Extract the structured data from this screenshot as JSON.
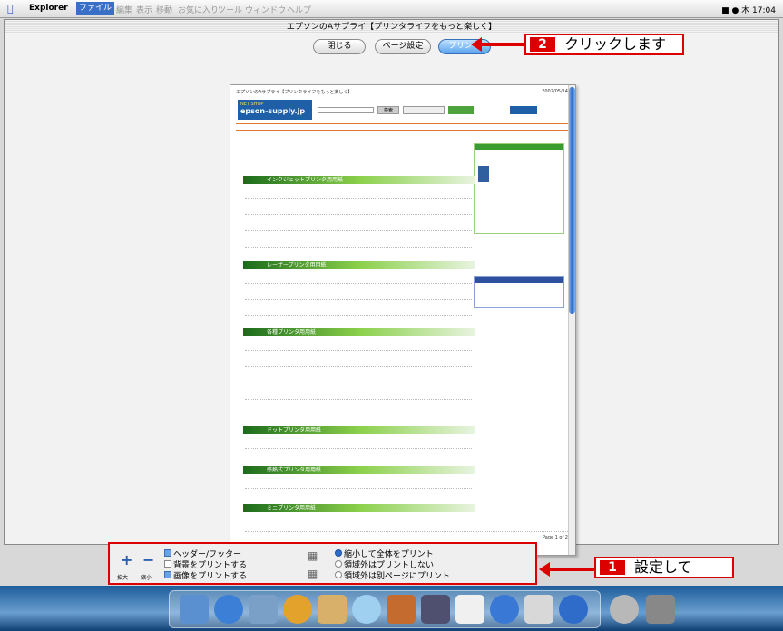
{
  "menubar": {
    "app_name": "Explorer",
    "active_menu": "ファイル",
    "menus": [
      "編集",
      "表示",
      "移動",
      "お気に入り",
      "ツール",
      "ウィンドウ",
      "ヘルプ"
    ],
    "clock": "木 17:04"
  },
  "window": {
    "title": "エプソンのAサプライ【プリンタライフをもっと楽しく】",
    "close_button": "閉じる",
    "page_setup_button": "ページ設定",
    "print_button": "プリント"
  },
  "callout_2": {
    "number": "2",
    "text": "クリックします"
  },
  "callout_1": {
    "number": "1",
    "text": "設定して"
  },
  "preview": {
    "header_left": "エプソンのAサプライ【プリンタライフをもっと楽しく】",
    "header_right": "2002/05/14",
    "brand_top": "NET SHOP",
    "brand_name": "epson-supply.jp",
    "search_button": "検索",
    "sections": [
      {
        "label": "インクジェットプリンタ用用紙"
      },
      {
        "label": "レーザープリンタ用用紙"
      },
      {
        "label": "各種プリンタ用用紙"
      },
      {
        "label": "ドットプリンタ用用紙"
      },
      {
        "label": "感熱式プリンタ用用紙"
      },
      {
        "label": "ミニプリンタ用用紙"
      }
    ],
    "footer_right": "Page 1 of 2"
  },
  "print_options": {
    "zoom_in": "拡大",
    "zoom_out": "縮小",
    "header_footer": "ヘッダー/フッター",
    "print_background": "背景をプリントする",
    "print_images": "画像をプリントする",
    "shrink_to_fit": "縮小して全体をプリント",
    "no_outside": "領域外はプリントしない",
    "outside_new_page": "領域外は別ページにプリント"
  }
}
